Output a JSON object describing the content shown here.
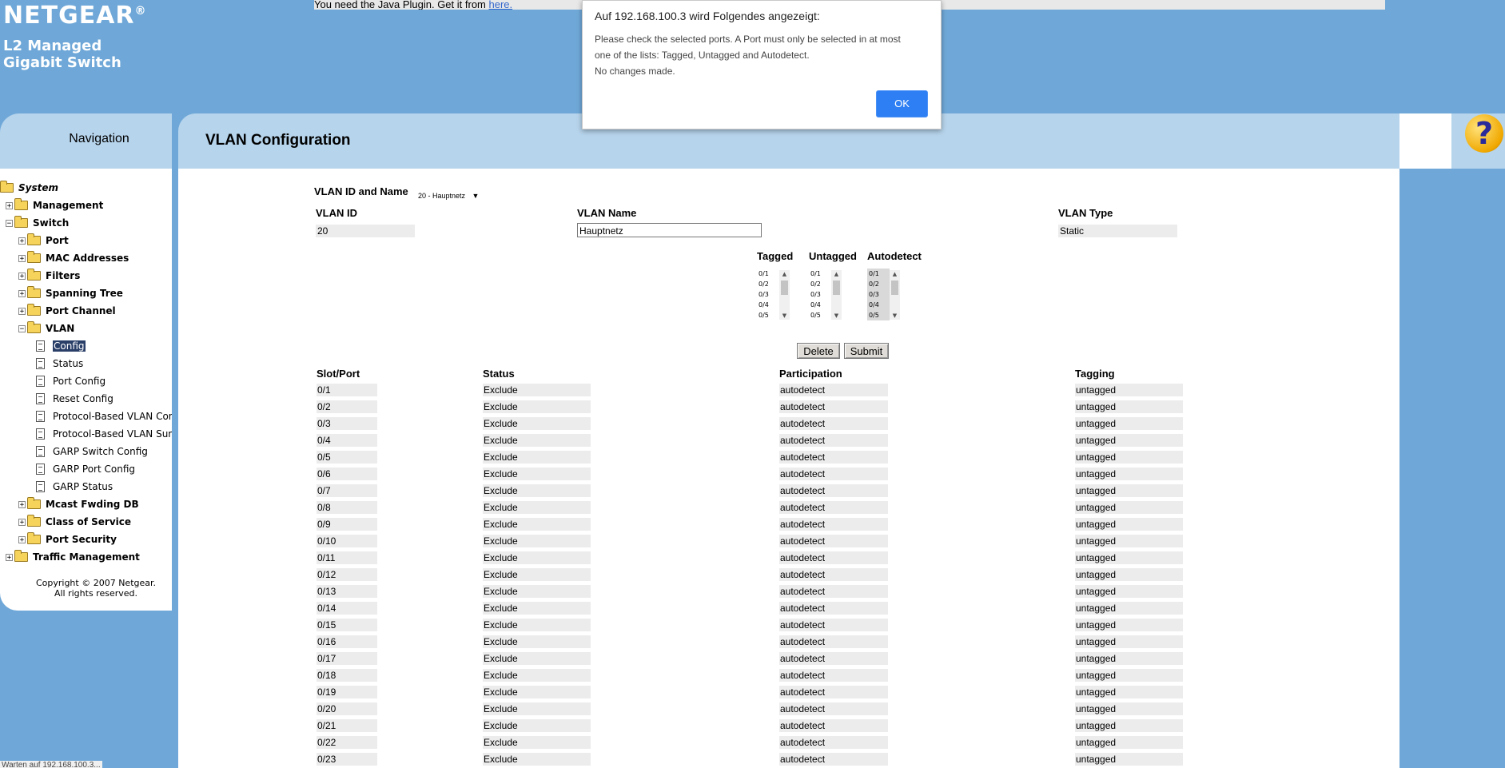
{
  "header": {
    "brand": "NETGEAR",
    "brand_mark": "®",
    "subtitle_line1": "L2 Managed",
    "subtitle_line2": "Gigabit Switch",
    "java_notice": "You need the Java Plugin. Get it from ",
    "java_link": "here."
  },
  "navigation": {
    "title": "Navigation",
    "tree": [
      {
        "label": "System",
        "level": 0,
        "kind": "folder",
        "expander": "",
        "bold": true,
        "italic": true
      },
      {
        "label": "Management",
        "level": 1,
        "kind": "folder",
        "expander": "+",
        "bold": true
      },
      {
        "label": "Switch",
        "level": 1,
        "kind": "folder",
        "expander": "−",
        "bold": true
      },
      {
        "label": "Port",
        "level": 2,
        "kind": "folder",
        "expander": "+",
        "bold": true
      },
      {
        "label": "MAC Addresses",
        "level": 2,
        "kind": "folder",
        "expander": "+",
        "bold": true
      },
      {
        "label": "Filters",
        "level": 2,
        "kind": "folder",
        "expander": "+",
        "bold": true
      },
      {
        "label": "Spanning Tree",
        "level": 2,
        "kind": "folder",
        "expander": "+",
        "bold": true
      },
      {
        "label": "Port Channel",
        "level": 2,
        "kind": "folder",
        "expander": "+",
        "bold": true
      },
      {
        "label": "VLAN",
        "level": 2,
        "kind": "folder",
        "expander": "−",
        "bold": true
      },
      {
        "label": "Config",
        "level": 3,
        "kind": "doc",
        "selected": true
      },
      {
        "label": "Status",
        "level": 3,
        "kind": "doc"
      },
      {
        "label": "Port Config",
        "level": 3,
        "kind": "doc"
      },
      {
        "label": "Reset Config",
        "level": 3,
        "kind": "doc"
      },
      {
        "label": "Protocol-Based VLAN Confi",
        "level": 3,
        "kind": "doc"
      },
      {
        "label": "Protocol-Based VLAN Sumi",
        "level": 3,
        "kind": "doc"
      },
      {
        "label": "GARP Switch Config",
        "level": 3,
        "kind": "doc"
      },
      {
        "label": "GARP Port Config",
        "level": 3,
        "kind": "doc"
      },
      {
        "label": "GARP Status",
        "level": 3,
        "kind": "doc"
      },
      {
        "label": "Mcast Fwding DB",
        "level": 2,
        "kind": "folder",
        "expander": "+",
        "bold": true
      },
      {
        "label": "Class of Service",
        "level": 2,
        "kind": "folder",
        "expander": "+",
        "bold": true
      },
      {
        "label": "Port Security",
        "level": 2,
        "kind": "folder",
        "expander": "+",
        "bold": true
      },
      {
        "label": "Traffic Management",
        "level": 1,
        "kind": "folder",
        "expander": "+",
        "bold": true
      }
    ],
    "copyright_line1": "Copyright © 2007 Netgear.",
    "copyright_line2": "All rights reserved."
  },
  "page": {
    "title": "VLAN Configuration",
    "help_icon": "?",
    "vlan_select_label": "VLAN ID and Name",
    "vlan_select_value": "20 - Hauptnetz",
    "dropdown_arrow": "▼",
    "vlan_id_label": "VLAN ID",
    "vlan_id_value": "20",
    "vlan_name_label": "VLAN Name",
    "vlan_name_value": "Hauptnetz",
    "vlan_type_label": "VLAN Type",
    "vlan_type_value": "Static",
    "lists": [
      {
        "label": "Tagged",
        "items": [
          "0/1",
          "0/2",
          "0/3",
          "0/4",
          "0/5"
        ],
        "highlighted": false
      },
      {
        "label": "Untagged",
        "items": [
          "0/1",
          "0/2",
          "0/3",
          "0/4",
          "0/5"
        ],
        "highlighted": false
      },
      {
        "label": "Autodetect",
        "items": [
          "0/1",
          "0/2",
          "0/3",
          "0/4",
          "0/5"
        ],
        "highlighted": true
      }
    ],
    "scroll_up": "▲",
    "scroll_down": "▼",
    "delete_label": "Delete",
    "submit_label": "Submit",
    "table": {
      "headers": [
        "Slot/Port",
        "Status",
        "Participation",
        "Tagging"
      ],
      "rows": [
        [
          "0/1",
          "Exclude",
          "autodetect",
          "untagged"
        ],
        [
          "0/2",
          "Exclude",
          "autodetect",
          "untagged"
        ],
        [
          "0/3",
          "Exclude",
          "autodetect",
          "untagged"
        ],
        [
          "0/4",
          "Exclude",
          "autodetect",
          "untagged"
        ],
        [
          "0/5",
          "Exclude",
          "autodetect",
          "untagged"
        ],
        [
          "0/6",
          "Exclude",
          "autodetect",
          "untagged"
        ],
        [
          "0/7",
          "Exclude",
          "autodetect",
          "untagged"
        ],
        [
          "0/8",
          "Exclude",
          "autodetect",
          "untagged"
        ],
        [
          "0/9",
          "Exclude",
          "autodetect",
          "untagged"
        ],
        [
          "0/10",
          "Exclude",
          "autodetect",
          "untagged"
        ],
        [
          "0/11",
          "Exclude",
          "autodetect",
          "untagged"
        ],
        [
          "0/12",
          "Exclude",
          "autodetect",
          "untagged"
        ],
        [
          "0/13",
          "Exclude",
          "autodetect",
          "untagged"
        ],
        [
          "0/14",
          "Exclude",
          "autodetect",
          "untagged"
        ],
        [
          "0/15",
          "Exclude",
          "autodetect",
          "untagged"
        ],
        [
          "0/16",
          "Exclude",
          "autodetect",
          "untagged"
        ],
        [
          "0/17",
          "Exclude",
          "autodetect",
          "untagged"
        ],
        [
          "0/18",
          "Exclude",
          "autodetect",
          "untagged"
        ],
        [
          "0/19",
          "Exclude",
          "autodetect",
          "untagged"
        ],
        [
          "0/20",
          "Exclude",
          "autodetect",
          "untagged"
        ],
        [
          "0/21",
          "Exclude",
          "autodetect",
          "untagged"
        ],
        [
          "0/22",
          "Exclude",
          "autodetect",
          "untagged"
        ],
        [
          "0/23",
          "Exclude",
          "autodetect",
          "untagged"
        ]
      ]
    }
  },
  "dialog": {
    "title": "Auf 192.168.100.3 wird Folgendes angezeigt:",
    "message_line1": "Please check the selected ports. A Port must only be selected in at most",
    "message_line2": "one of the lists: Tagged, Untagged and Autodetect.",
    "message_line3": "No changes made.",
    "ok_label": "OK"
  },
  "statusbar": {
    "text": "Warten auf 192.168.100.3..."
  },
  "colors": {
    "page_bg": "#6fa8d8",
    "panel_header": "#b6d4ec",
    "dialog_ok": "#2d7ff3",
    "nav_selected": "#2a3f68"
  }
}
